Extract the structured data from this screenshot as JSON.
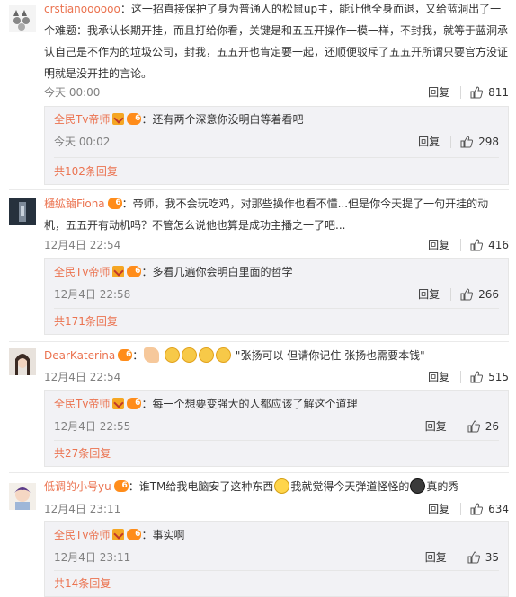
{
  "colors": {
    "accent": "#eb7350",
    "meta": "#808080",
    "reply_bg": "#f2f2f5"
  },
  "labels": {
    "reply": "回复",
    "like_icon": "thumbs-up-icon"
  },
  "comments": [
    {
      "user": "crstianoooooo",
      "text": "：这一招直接保护了身为普通人的松鼠up主，能让他全身而退，又给蓝洞出了一个难题：我承认长期开挂，而且打给你看，关键是和五五开操作一模一样，不封我，就等于蓝洞承认自己是不作为的垃圾公司，封我，五五开也肯定要一起，还顺便驳斥了五五开所谓只要官方没证明就是没开挂的言论。",
      "time": "今天 00:00",
      "likes": "811",
      "reply": {
        "user": "全民Tv帝师",
        "text": "：还有两个深意你没明白等着看吧",
        "time": "今天 00:02",
        "likes": "298"
      },
      "more": "共102条回复"
    },
    {
      "user": "樋絋鏀Fiona",
      "text": "：帝师，我不会玩吃鸡，对那些操作也看不懂...但是你今天提了一句开挂的动机，五五开有动机吗？不管怎么说他也算是成功主播之一了吧...",
      "time": "12月4日 22:54",
      "likes": "416",
      "reply": {
        "user": "全民Tv帝师",
        "text": "：多看几遍你会明白里面的哲学",
        "time": "12月4日 22:58",
        "likes": "266"
      },
      "more": "共171条回复"
    },
    {
      "user": "DearKaterina",
      "text": "\"张扬可以 但请你记住 张扬也需要本钱\"",
      "time": "12月4日 22:54",
      "likes": "515",
      "reply": {
        "user": "全民Tv帝师",
        "text": "：每一个想要变强大的人都应该了解这个道理",
        "time": "12月4日 22:55",
        "likes": "26"
      },
      "more": "共27条回复"
    },
    {
      "user": "低调的小号yu",
      "text_a": "：谁TM给我电脑安了这种东西",
      "text_b": "我就觉得今天弹道怪怪的",
      "text_c": "真的秀",
      "time": "12月4日 23:11",
      "likes": "634",
      "reply": {
        "user": "全民Tv帝师",
        "text": "：事实啊",
        "time": "12月4日 23:11",
        "likes": "35"
      },
      "more": "共14条回复"
    }
  ]
}
